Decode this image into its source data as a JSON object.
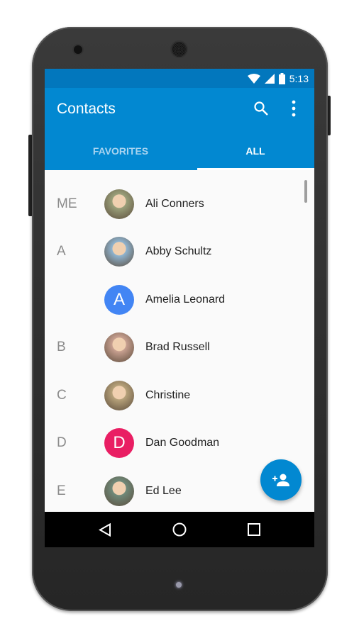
{
  "status_bar": {
    "time": "5:13"
  },
  "app_bar": {
    "title": "Contacts",
    "search_icon": "search-icon",
    "menu_icon": "more-vert-icon"
  },
  "tabs": [
    {
      "label": "FAVORITES",
      "selected": false
    },
    {
      "label": "ALL",
      "selected": true
    }
  ],
  "contacts": [
    {
      "letter": "ME",
      "name": "Ali Conners",
      "avatar": "photo",
      "color": "#9aa07a"
    },
    {
      "letter": "A",
      "name": "Abby Schultz",
      "avatar": "photo",
      "color": "#8fb4d0"
    },
    {
      "letter": "",
      "name": "Amelia Leonard",
      "avatar": "A",
      "color": "#4285f4"
    },
    {
      "letter": "B",
      "name": "Brad Russell",
      "avatar": "photo",
      "color": "#c8a090"
    },
    {
      "letter": "C",
      "name": "Christine",
      "avatar": "photo",
      "color": "#b7a27a"
    },
    {
      "letter": "D",
      "name": "Dan Goodman",
      "avatar": "D",
      "color": "#e91e63"
    },
    {
      "letter": "E",
      "name": "Ed Lee",
      "avatar": "photo",
      "color": "#6f8a7a"
    }
  ],
  "fab": {
    "icon": "add-person-icon"
  },
  "nav_bar": {
    "icons": [
      "back-icon",
      "home-icon",
      "recents-icon"
    ]
  },
  "colors": {
    "primary": "#0288d1",
    "primary_dark": "#0277bd"
  }
}
